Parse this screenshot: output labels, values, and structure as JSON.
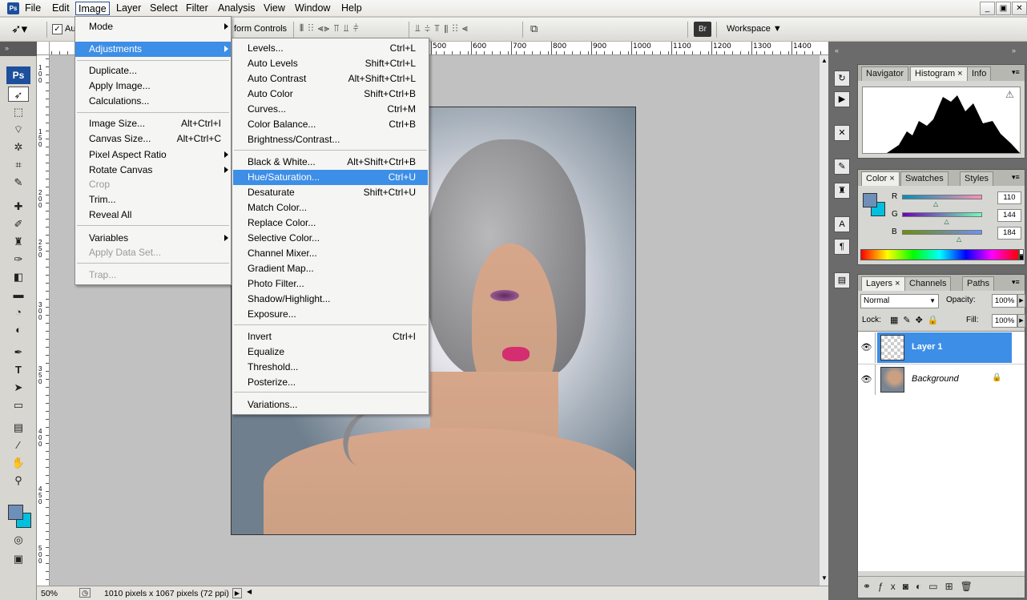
{
  "app": {
    "icon_label": "Ps"
  },
  "menubar": {
    "items": [
      "File",
      "Edit",
      "Image",
      "Layer",
      "Select",
      "Filter",
      "Analysis",
      "View",
      "Window",
      "Help"
    ],
    "active": "Image"
  },
  "window_controls": {
    "minimize": "_",
    "restore": "▣",
    "close": "✕"
  },
  "optionsbar": {
    "auto_label": "Au",
    "transform_label": "form Controls",
    "workspace_label": "Workspace ▼",
    "br_label": "Br"
  },
  "rulers": {
    "h_labels": [
      "500",
      "600",
      "700",
      "800",
      "900",
      "1000",
      "1100",
      "1200",
      "1300",
      "1400"
    ],
    "v_labels": [
      "1",
      "0",
      "0",
      "1",
      "5",
      "0",
      "2",
      "0",
      "0",
      "2",
      "5",
      "0",
      "3",
      "0",
      "0",
      "3",
      "5",
      "0",
      "4",
      "0",
      "0",
      "4",
      "5",
      "0",
      "5",
      "0",
      "0"
    ]
  },
  "image_menu": {
    "items": [
      {
        "label": "Mode",
        "submenu": true
      },
      {
        "label": "Adjustments",
        "submenu": true,
        "highlight": true
      },
      {
        "label": "Duplicate..."
      },
      {
        "label": "Apply Image..."
      },
      {
        "label": "Calculations..."
      },
      {
        "label": "Image Size...",
        "shortcut": "Alt+Ctrl+I"
      },
      {
        "label": "Canvas Size...",
        "shortcut": "Alt+Ctrl+C"
      },
      {
        "label": "Pixel Aspect Ratio",
        "submenu": true
      },
      {
        "label": "Rotate Canvas",
        "submenu": true
      },
      {
        "label": "Crop",
        "disabled": true
      },
      {
        "label": "Trim..."
      },
      {
        "label": "Reveal All"
      },
      {
        "label": "Variables",
        "submenu": true
      },
      {
        "label": "Apply Data Set...",
        "disabled": true
      },
      {
        "label": "Trap...",
        "disabled": true
      }
    ]
  },
  "adjust_menu": {
    "items": [
      {
        "label": "Levels...",
        "shortcut": "Ctrl+L"
      },
      {
        "label": "Auto Levels",
        "shortcut": "Shift+Ctrl+L"
      },
      {
        "label": "Auto Contrast",
        "shortcut": "Alt+Shift+Ctrl+L"
      },
      {
        "label": "Auto Color",
        "shortcut": "Shift+Ctrl+B"
      },
      {
        "label": "Curves...",
        "shortcut": "Ctrl+M"
      },
      {
        "label": "Color Balance...",
        "shortcut": "Ctrl+B"
      },
      {
        "label": "Brightness/Contrast..."
      },
      {
        "label": "Black & White...",
        "shortcut": "Alt+Shift+Ctrl+B"
      },
      {
        "label": "Hue/Saturation...",
        "shortcut": "Ctrl+U",
        "highlight": true
      },
      {
        "label": "Desaturate",
        "shortcut": "Shift+Ctrl+U"
      },
      {
        "label": "Match Color..."
      },
      {
        "label": "Replace Color..."
      },
      {
        "label": "Selective Color..."
      },
      {
        "label": "Channel Mixer..."
      },
      {
        "label": "Gradient Map..."
      },
      {
        "label": "Photo Filter..."
      },
      {
        "label": "Shadow/Highlight..."
      },
      {
        "label": "Exposure..."
      },
      {
        "label": "Invert",
        "shortcut": "Ctrl+I"
      },
      {
        "label": "Equalize"
      },
      {
        "label": "Threshold..."
      },
      {
        "label": "Posterize..."
      },
      {
        "label": "Variations..."
      }
    ]
  },
  "navigator_panel": {
    "tabs": [
      "Navigator",
      "Histogram",
      "Info"
    ],
    "active": "Histogram",
    "warning": "⚠"
  },
  "color_panel": {
    "tabs": [
      "Color",
      "Swatches",
      "Styles"
    ],
    "active": "Color",
    "channels": [
      {
        "label": "R",
        "value": "110",
        "level": 0.43
      },
      {
        "label": "G",
        "value": "144",
        "level": 0.565
      },
      {
        "label": "B",
        "value": "184",
        "level": 0.72
      }
    ],
    "foreground": "#6e90b8",
    "background": "#00c0e0"
  },
  "layers_panel": {
    "tabs": [
      "Layers",
      "Channels",
      "Paths"
    ],
    "active": "Layers",
    "blend_mode": "Normal",
    "opacity_label": "Opacity:",
    "opacity": "100%",
    "lock_label": "Lock:",
    "fill_label": "Fill:",
    "fill": "100%",
    "layers": [
      {
        "name": "Layer 1",
        "selected": true
      },
      {
        "name": "Background",
        "locked": true
      }
    ]
  },
  "statusbar": {
    "zoom": "50%",
    "doc_info": "1010 pixels x 1067 pixels (72 ppi)"
  },
  "colors": {
    "menu_highlight": "#3d8ee6",
    "layer_selected": "#3d8ee6"
  }
}
